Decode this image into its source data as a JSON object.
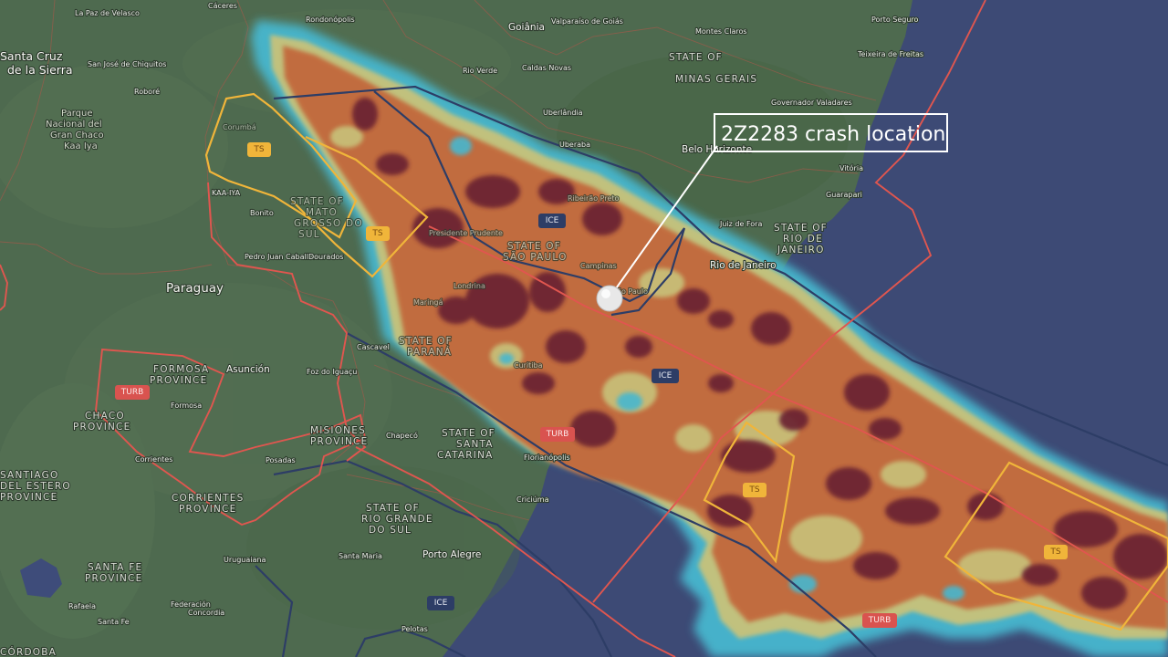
{
  "callout": {
    "text": "2Z2283 crash location"
  },
  "advisory_tags": {
    "ts_1": "TS",
    "ts_2": "TS",
    "ts_3": "TS",
    "ts_4": "TS",
    "ice_1": "ICE",
    "ice_2": "ICE",
    "ice_3": "ICE",
    "turb_1": "TURB",
    "turb_2": "TURB",
    "turb_3": "TURB"
  },
  "places": {
    "la_paz_velasco": "La Paz de Velasco",
    "caceres": "Cáceres",
    "rondonopolis": "Rondonópolis",
    "goiania": "Goiânia",
    "valparaiso": "Valparaíso de Goiás",
    "montes_claros": "Montes Claros",
    "porto_seguro": "Porto Seguro",
    "santa_cruz": "Santa Cruz",
    "de_la_sierra": "de la Sierra",
    "san_jose_chiquitos": "San José de Chiquitos",
    "rio_verde": "Rio Verde",
    "caldas_novas": "Caldas Novas",
    "state_minas": "STATE OF",
    "minas_gerais": "MINAS GERAIS",
    "teixeira": "Teixeira de Freitas",
    "robore": "Roboré",
    "uberlandia": "Uberlândia",
    "governador": "Governador Valadares",
    "parque_1": "Parque",
    "parque_2": "Nacional del",
    "parque_3": "Gran Chaco",
    "parque_4": "Kaa Iya",
    "corumba": "Corumbá",
    "uberaba": "Uberaba",
    "belo_horizonte": "Belo Horizonte",
    "vitoria": "Vitória",
    "guarapari": "Guarapari",
    "ribeirao_preto": "Ribeirão Preto",
    "state_ms_1": "STATE OF",
    "state_ms_2": "MATO",
    "state_ms_3": "GROSSO DO",
    "state_ms_4": "SUL",
    "kaa_iya": "KAA-IYA",
    "bonito": "Bonito",
    "juiz_de_fora": "Juiz de Fora",
    "state_rj_1": "STATE OF",
    "state_rj_2": "RIO DE",
    "state_rj_3": "JANEIRO",
    "presidente_prudente": "Presidente Prudente",
    "state_sp_1": "STATE OF",
    "state_sp_2": "SÃO PAULO",
    "pedro_juan": "Pedro Juan Caballero",
    "dourados": "Dourados",
    "campinas": "Campinas",
    "sao_paulo": "São Paulo",
    "rio_de_janeiro": "Rio de Janeiro",
    "paraguay": "Paraguay",
    "maringa": "Maringá",
    "londrina": "Londrina",
    "cascavel": "Cascavel",
    "state_pr_1": "STATE OF",
    "state_pr_2": "PARANÁ",
    "curitiba": "Curitiba",
    "asuncion": "Asunción",
    "formosa_prov_1": "FORMOSA",
    "formosa_prov_2": "PROVINCE",
    "foz": "Foz do Iguaçu",
    "formosa": "Formosa",
    "chaco_1": "CHACO",
    "chaco_2": "PROVINCE",
    "misiones_1": "MISIONES",
    "misiones_2": "PROVINCE",
    "chapeco": "Chapecó",
    "state_sc_1": "STATE OF",
    "state_sc_2": "SANTA",
    "state_sc_3": "CATARINA",
    "florianopolis": "Florianópolis",
    "corrientes": "Corrientes",
    "posadas": "Posadas",
    "santiago_1": "SANTIAGO",
    "santiago_2": "DEL ESTERO",
    "santiago_3": "PROVINCE",
    "corrientes_prov_1": "CORRIENTES",
    "corrientes_prov_2": "PROVINCE",
    "state_rs_1": "STATE OF",
    "state_rs_2": "RIO GRANDE",
    "state_rs_3": "DO SUL",
    "criciuma": "Criciúma",
    "santa_fe_1": "SANTA FE",
    "santa_fe_2": "PROVINCE",
    "uruguaiana": "Uruguaiana",
    "santa_maria": "Santa Maria",
    "porto_alegre": "Porto Alegre",
    "rafaela": "Rafaela",
    "federacion": "Federación",
    "concordia": "Concordia",
    "santa_fe": "Santa Fe",
    "pelotas": "Pelotas",
    "cordoba": "CÓRDOBA"
  },
  "colors": {
    "land": "#4e6a4f",
    "ocean": "#3d4a75",
    "radar_cyan": "#46b7cf",
    "radar_yellow": "#c8c27a",
    "radar_orange": "#c26a3e",
    "radar_dark": "#6a2231",
    "ts_outline": "#f0b53a",
    "ice_outline": "#2d3d66",
    "turb_outline": "#e0564f",
    "crash_marker": "#e8e8e8"
  }
}
